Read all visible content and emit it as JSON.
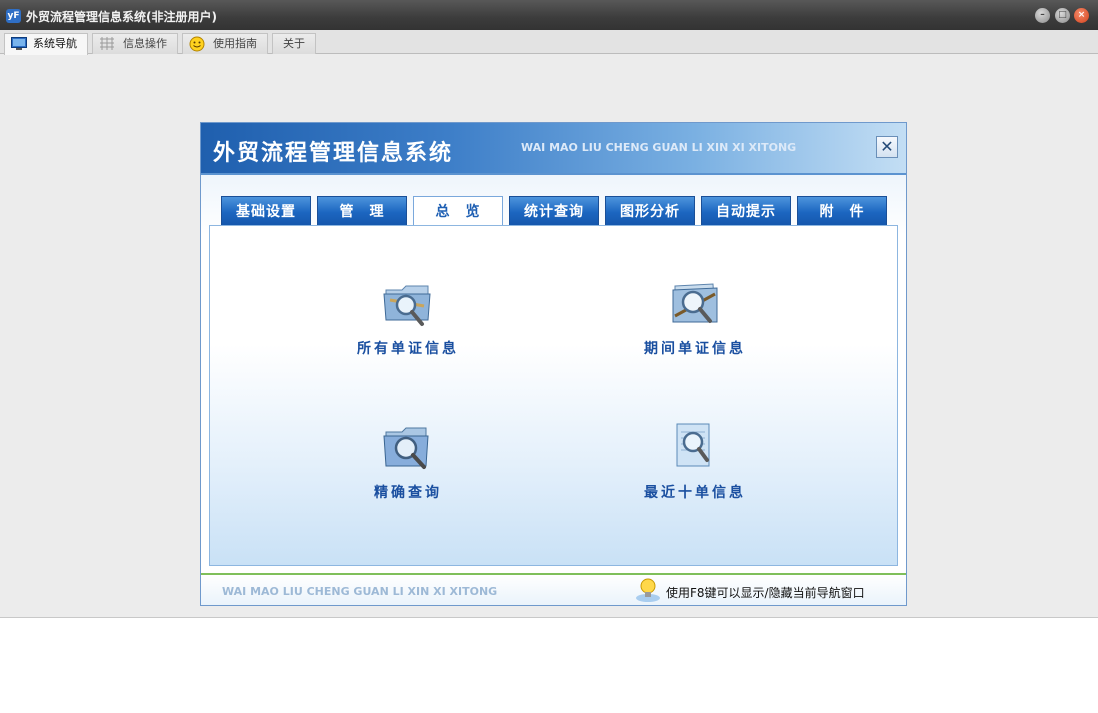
{
  "window": {
    "title": "外贸流程管理信息系统(非注册用户)",
    "logo_text": "yF",
    "controls": [
      "minimize",
      "maximize",
      "close"
    ]
  },
  "tabs": [
    {
      "label": "系统导航",
      "icon": "monitor-icon",
      "active": true
    },
    {
      "label": "信息操作",
      "icon": "grid-icon",
      "active": false
    },
    {
      "label": "使用指南",
      "icon": "smiley-icon",
      "active": false
    },
    {
      "label": "关于",
      "icon": "",
      "active": false
    }
  ],
  "panel": {
    "title": "外贸流程管理信息系统",
    "subtitle": "WAI MAO LIU CHENG GUAN LI XIN XI XITONG",
    "close_symbol": "✕",
    "nav_tabs": [
      {
        "label": "基础设置",
        "active": false
      },
      {
        "label": "管　理",
        "active": false
      },
      {
        "label": "总　览",
        "active": true
      },
      {
        "label": "统计查询",
        "active": false
      },
      {
        "label": "图形分析",
        "active": false
      },
      {
        "label": "自动提示",
        "active": false
      },
      {
        "label": "附　件",
        "active": false
      }
    ],
    "items": [
      {
        "label": "所有单证信息",
        "icon": "folder-search-icon"
      },
      {
        "label": "期间单证信息",
        "icon": "folder-calendar-search-icon"
      },
      {
        "label": "精确查询",
        "icon": "folder-magnifier-icon"
      },
      {
        "label": "最近十单信息",
        "icon": "document-search-icon"
      }
    ],
    "footer": {
      "text": "WAI MAO LIU CHENG GUAN LI XIN XI XITONG",
      "hint": "使用F8键可以显示/隐藏当前导航窗口",
      "hint_icon": "lightbulb-icon"
    }
  },
  "colors": {
    "header_blue": "#1f5fae",
    "tab_blue": "#1c66c0",
    "label_blue": "#1a4fa0",
    "footer_green": "#7fbf5a"
  }
}
